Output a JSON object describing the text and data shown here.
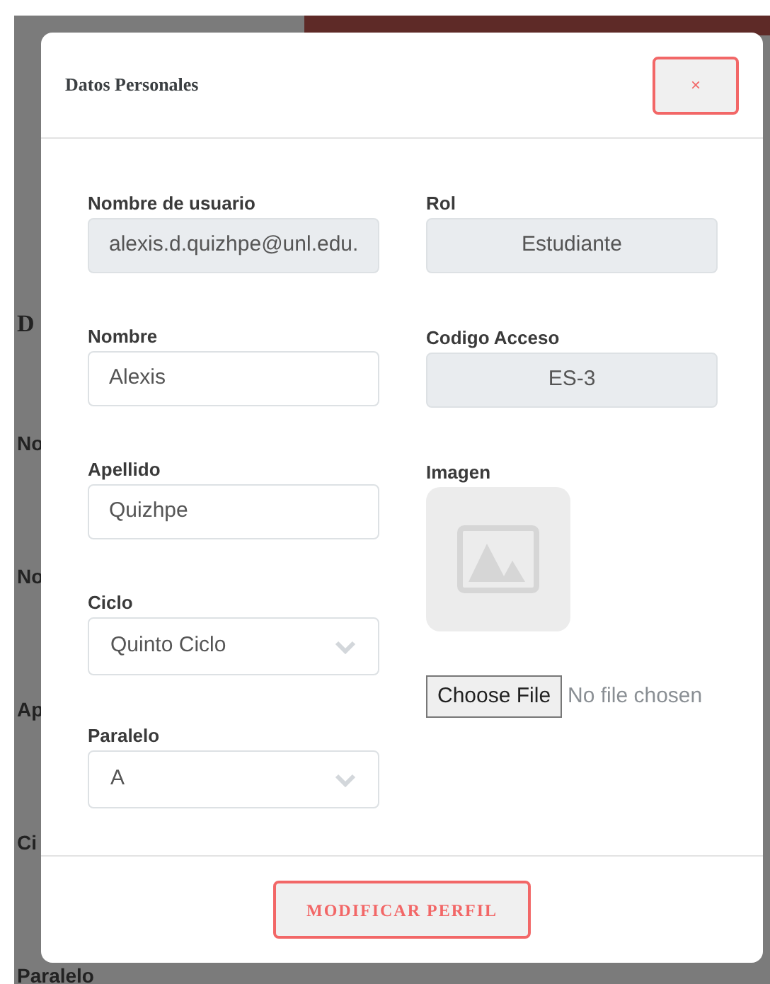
{
  "background": {
    "labels": [
      {
        "text": "D",
        "kind": "heading"
      },
      {
        "text": "No",
        "kind": "label"
      },
      {
        "text": "No",
        "kind": "label"
      },
      {
        "text": "Ap",
        "kind": "label"
      },
      {
        "text": "Ci",
        "kind": "label"
      },
      {
        "text": "Paralelo",
        "kind": "label"
      }
    ]
  },
  "modal": {
    "title": "Datos Personales",
    "close": "×",
    "columns": [
      [
        {
          "label": "Nombre de usuario",
          "kind": "readonly",
          "value": "alexis.d.quizhpe@unl.edu."
        },
        {
          "label": "Nombre",
          "kind": "input",
          "value": "Alexis"
        },
        {
          "label": "Apellido",
          "kind": "input",
          "value": "Quizhpe"
        },
        {
          "label": "Ciclo",
          "kind": "select",
          "value": "Quinto Ciclo"
        },
        {
          "label": "Paralelo",
          "kind": "select",
          "value": "A"
        }
      ],
      [
        {
          "label": "Rol",
          "kind": "readonly",
          "value": "Estudiante"
        },
        {
          "label": "Codigo Acceso",
          "kind": "readonly",
          "value": "ES-3"
        },
        {
          "label": "Imagen",
          "kind": "image",
          "button": "Choose File",
          "status": "No file chosen"
        }
      ]
    ],
    "submit": "MODIFICAR PERFIL"
  }
}
